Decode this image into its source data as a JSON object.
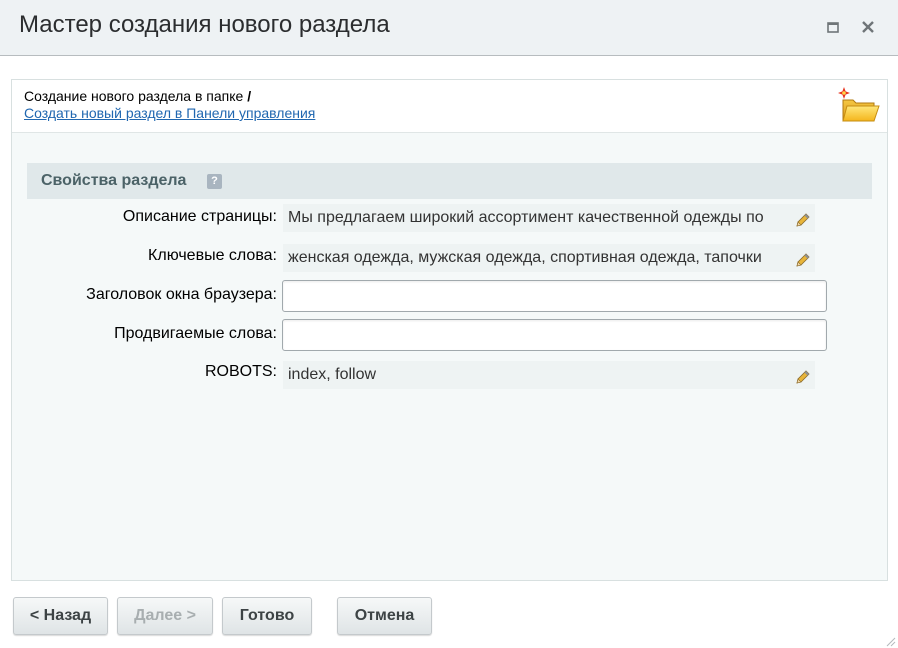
{
  "window": {
    "title": "Мастер создания нового раздела",
    "controls": [
      "maximize-icon",
      "close-icon"
    ]
  },
  "info": {
    "create_in_folder_text": "Создание нового раздела в папке",
    "folder_path": "/",
    "control_panel_link": "Создать новый раздел в Панели управления",
    "icon": "folder-new-icon"
  },
  "section": {
    "title": "Свойства раздела",
    "help_icon_text": "?"
  },
  "fields": [
    {
      "label": "Описание страницы:",
      "type": "editable-text",
      "value": "Мы предлагаем широкий ассортимент качественной одежды по"
    },
    {
      "label": "Ключевые слова:",
      "type": "editable-text",
      "value": "женская одежда, мужская одежда, спортивная одежда, тапочки"
    },
    {
      "label": "Заголовок окна браузера:",
      "type": "input",
      "value": "",
      "placeholder": ""
    },
    {
      "label": "Продвигаемые слова:",
      "type": "input",
      "value": "",
      "placeholder": ""
    },
    {
      "label": "ROBOTS:",
      "type": "editable-text",
      "value": "index, follow"
    }
  ],
  "footer": {
    "back_label": "< Назад",
    "next_label": "Далее >",
    "done_label": "Готово",
    "cancel_label": "Отмена"
  },
  "colors": {
    "titlebar_bg": "#eef2f4",
    "section_header_bg": "#e0e8ea",
    "link": "#2067b0",
    "panel_bg": "#f5f9f9"
  }
}
